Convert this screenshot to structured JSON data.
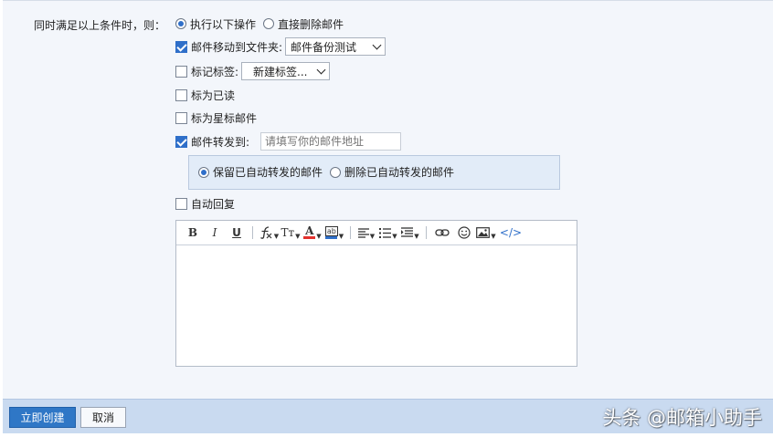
{
  "condition_label": "同时满足以上条件时，则：",
  "mode_options": [
    {
      "label": "执行以下操作",
      "selected": true
    },
    {
      "label": "直接删除邮件",
      "selected": false
    }
  ],
  "move_to_folder": {
    "label": "邮件移动到文件夹:",
    "checked": true,
    "selected_folder": "邮件备份测试"
  },
  "tag": {
    "label": "标记标签:",
    "checked": false,
    "selected_tag": "新建标签..."
  },
  "mark_read": {
    "label": "标为已读",
    "checked": false
  },
  "mark_star": {
    "label": "标为星标邮件",
    "checked": false
  },
  "forward": {
    "label": "邮件转发到:",
    "checked": true,
    "placeholder": "请填写你的邮件地址",
    "keep_option": {
      "label": "保留已自动转发的邮件",
      "selected": true
    },
    "delete_option": {
      "label": "删除已自动转发的邮件",
      "selected": false
    }
  },
  "auto_reply": {
    "label": "自动回复",
    "checked": false
  },
  "editor_toolbar": {
    "bold": "B",
    "italic": "I",
    "underline": "U",
    "font_size": "Tт",
    "font_color": "A",
    "bg_color": "ab",
    "code": "</>"
  },
  "buttons": {
    "create": "立即创建",
    "cancel": "取消"
  },
  "watermark": "头条 @邮箱小助手",
  "colors": {
    "accent": "#2f77c6",
    "panel": "#f3f6fb",
    "footer": "#c9daf0"
  }
}
